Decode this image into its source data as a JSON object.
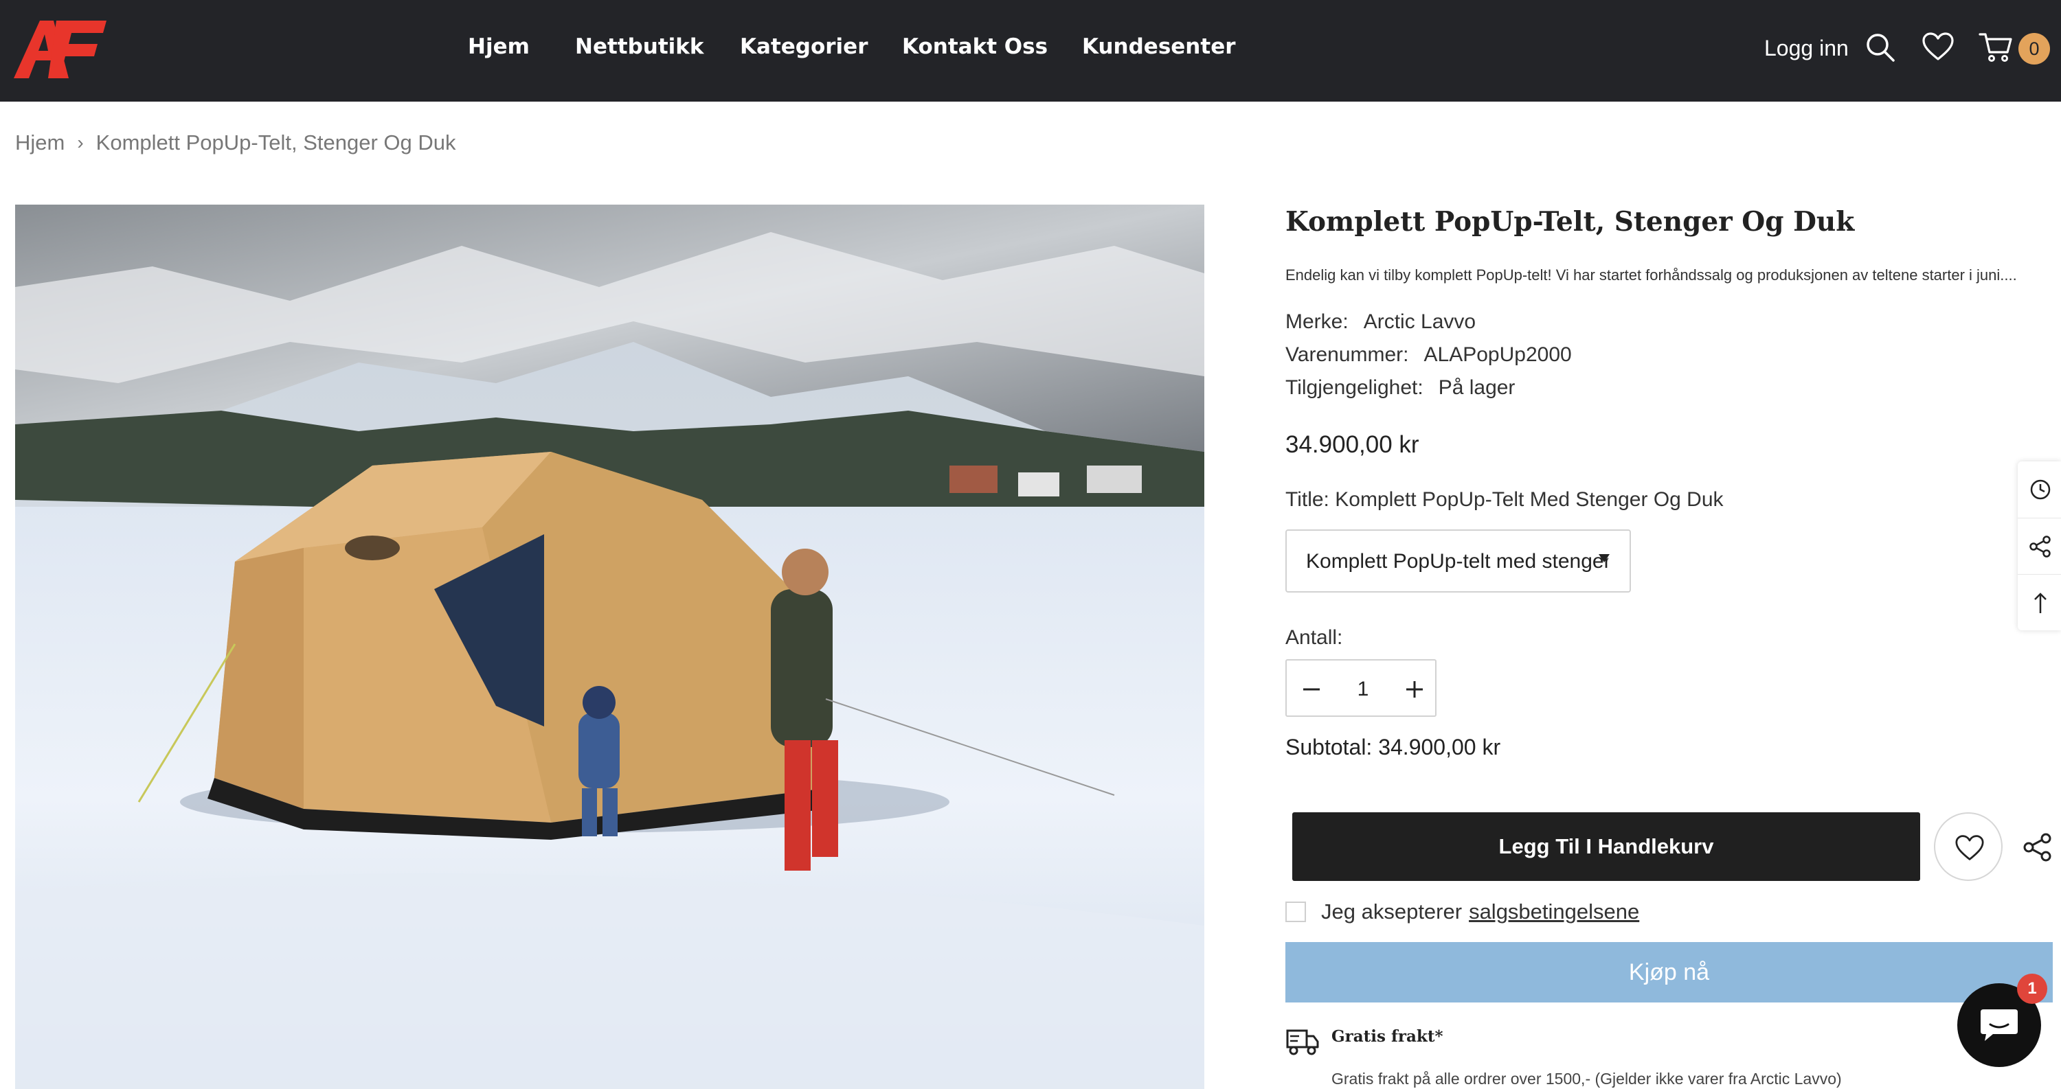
{
  "brand": {
    "logo_text": "AF",
    "logo_color": "#e8352b"
  },
  "nav": {
    "items": [
      "Hjem",
      "Nettbutikk",
      "Kategorier",
      "Kontakt Oss",
      "Kundesenter"
    ]
  },
  "header": {
    "login_label": "Logg inn",
    "cart_count": "0",
    "icons": [
      "search-icon",
      "heart-icon",
      "cart-icon"
    ]
  },
  "breadcrumb": {
    "home": "Hjem",
    "current": "Komplett PopUp-Telt, Stenger Og Duk"
  },
  "product": {
    "title": "Komplett PopUp-Telt, Stenger Og Duk",
    "description": "Endelig kan vi tilby komplett PopUp-telt! Vi har startet forhåndssalg og produksjonen av teltene starter i juni....",
    "brand_label": "Merke:",
    "brand_value": "Arctic Lavvo",
    "sku_label": "Varenummer:",
    "sku_value": "ALAPopUp2000",
    "availability_label": "Tilgjengelighet:",
    "availability_value": "På lager",
    "price": "34.900,00 kr",
    "variant_label": "Title:",
    "variant_value": "Komplett PopUp-Telt Med Stenger Og Duk",
    "variant_select_text": "Komplett PopUp-telt med stenger o",
    "quantity_label": "Antall:",
    "quantity": "1",
    "subtotal": "Subtotal: 34.900,00 kr",
    "add_to_cart": "Legg Til I Handlekurv",
    "accept_prefix": "Jeg aksepterer",
    "accept_link": "salgsbetingelsene",
    "buy_now": "Kjøp nå",
    "shipping_title": "Gratis frakt*",
    "shipping_text": "Gratis frakt på alle ordrer over 1500,- (Gjelder ikke varer fra Arctic Lavvo)"
  },
  "chat": {
    "badge": "1"
  },
  "colors": {
    "header_bg": "#232428",
    "accent_orange": "#e3a35b",
    "buy_now": "#8fb9dc",
    "add_to_cart": "#202020"
  }
}
